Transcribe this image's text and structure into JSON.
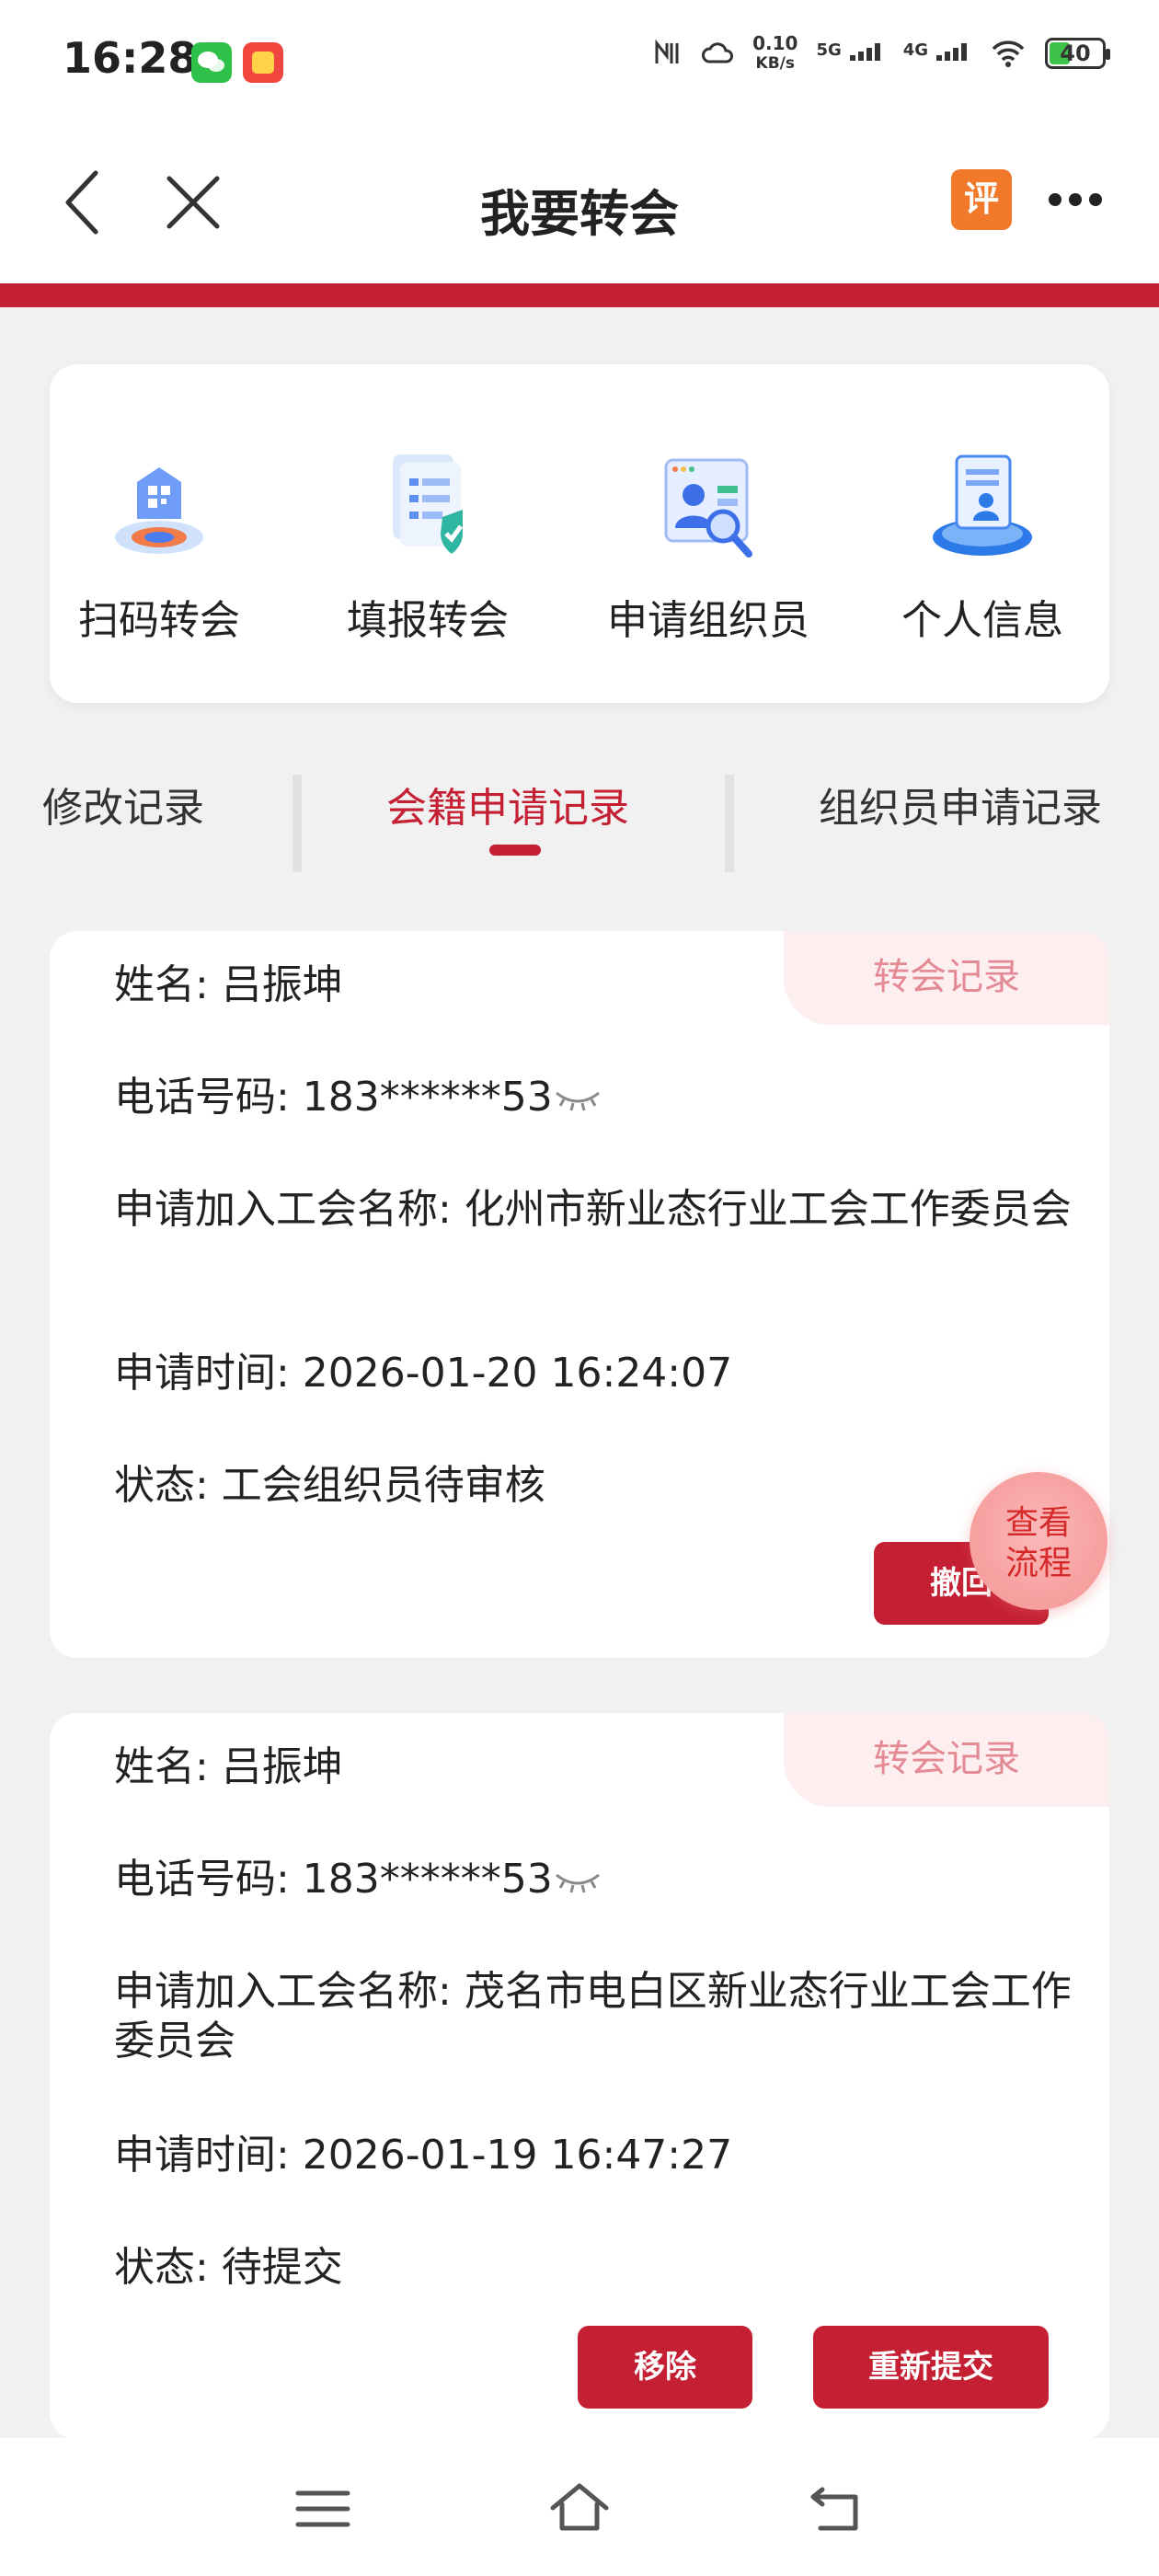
{
  "status_bar": {
    "time": "16:28",
    "net_speed_value": "0.10",
    "net_speed_unit": "KB/s",
    "sig1": "5G",
    "sig2": "4G",
    "battery": "40"
  },
  "header": {
    "title": "我要转会",
    "eval_label": "评"
  },
  "actions": [
    {
      "label": "扫码转会",
      "icon": "qr-transfer-icon"
    },
    {
      "label": "填报转会",
      "icon": "form-transfer-icon"
    },
    {
      "label": "申请组织员",
      "icon": "apply-organizer-icon"
    },
    {
      "label": "个人信息",
      "icon": "personal-info-icon"
    }
  ],
  "tabs": [
    {
      "label": "修改记录"
    },
    {
      "label": "会籍申请记录",
      "active": true
    },
    {
      "label": "组织员申请记录"
    }
  ],
  "records": [
    {
      "tag": "转会记录",
      "name": "姓名: 吕振坤",
      "phone": "电话号码: 183******53",
      "union": "申请加入工会名称: 化州市新业态行业工会工作委员会",
      "time": "申请时间: 2026-01-20 16:24:07",
      "status": "状态: 工会组织员待审核",
      "buttons": [
        "撤回"
      ]
    },
    {
      "tag": "转会记录",
      "name": "姓名: 吕振坤",
      "phone": "电话号码: 183******53",
      "union": "申请加入工会名称: 茂名市电白区新业态行业工会工作委员会",
      "time": "申请时间: 2026-01-19 16:47:27",
      "status": "状态: 待提交",
      "buttons": [
        "移除",
        "重新提交"
      ]
    }
  ],
  "float_button": {
    "line1": "查看",
    "line2": "流程"
  },
  "colors": {
    "primary": "#c41f33",
    "tag_bg": "#fdeef0",
    "tag_text": "#e38a94",
    "float_bg": "#f7a1a1"
  }
}
